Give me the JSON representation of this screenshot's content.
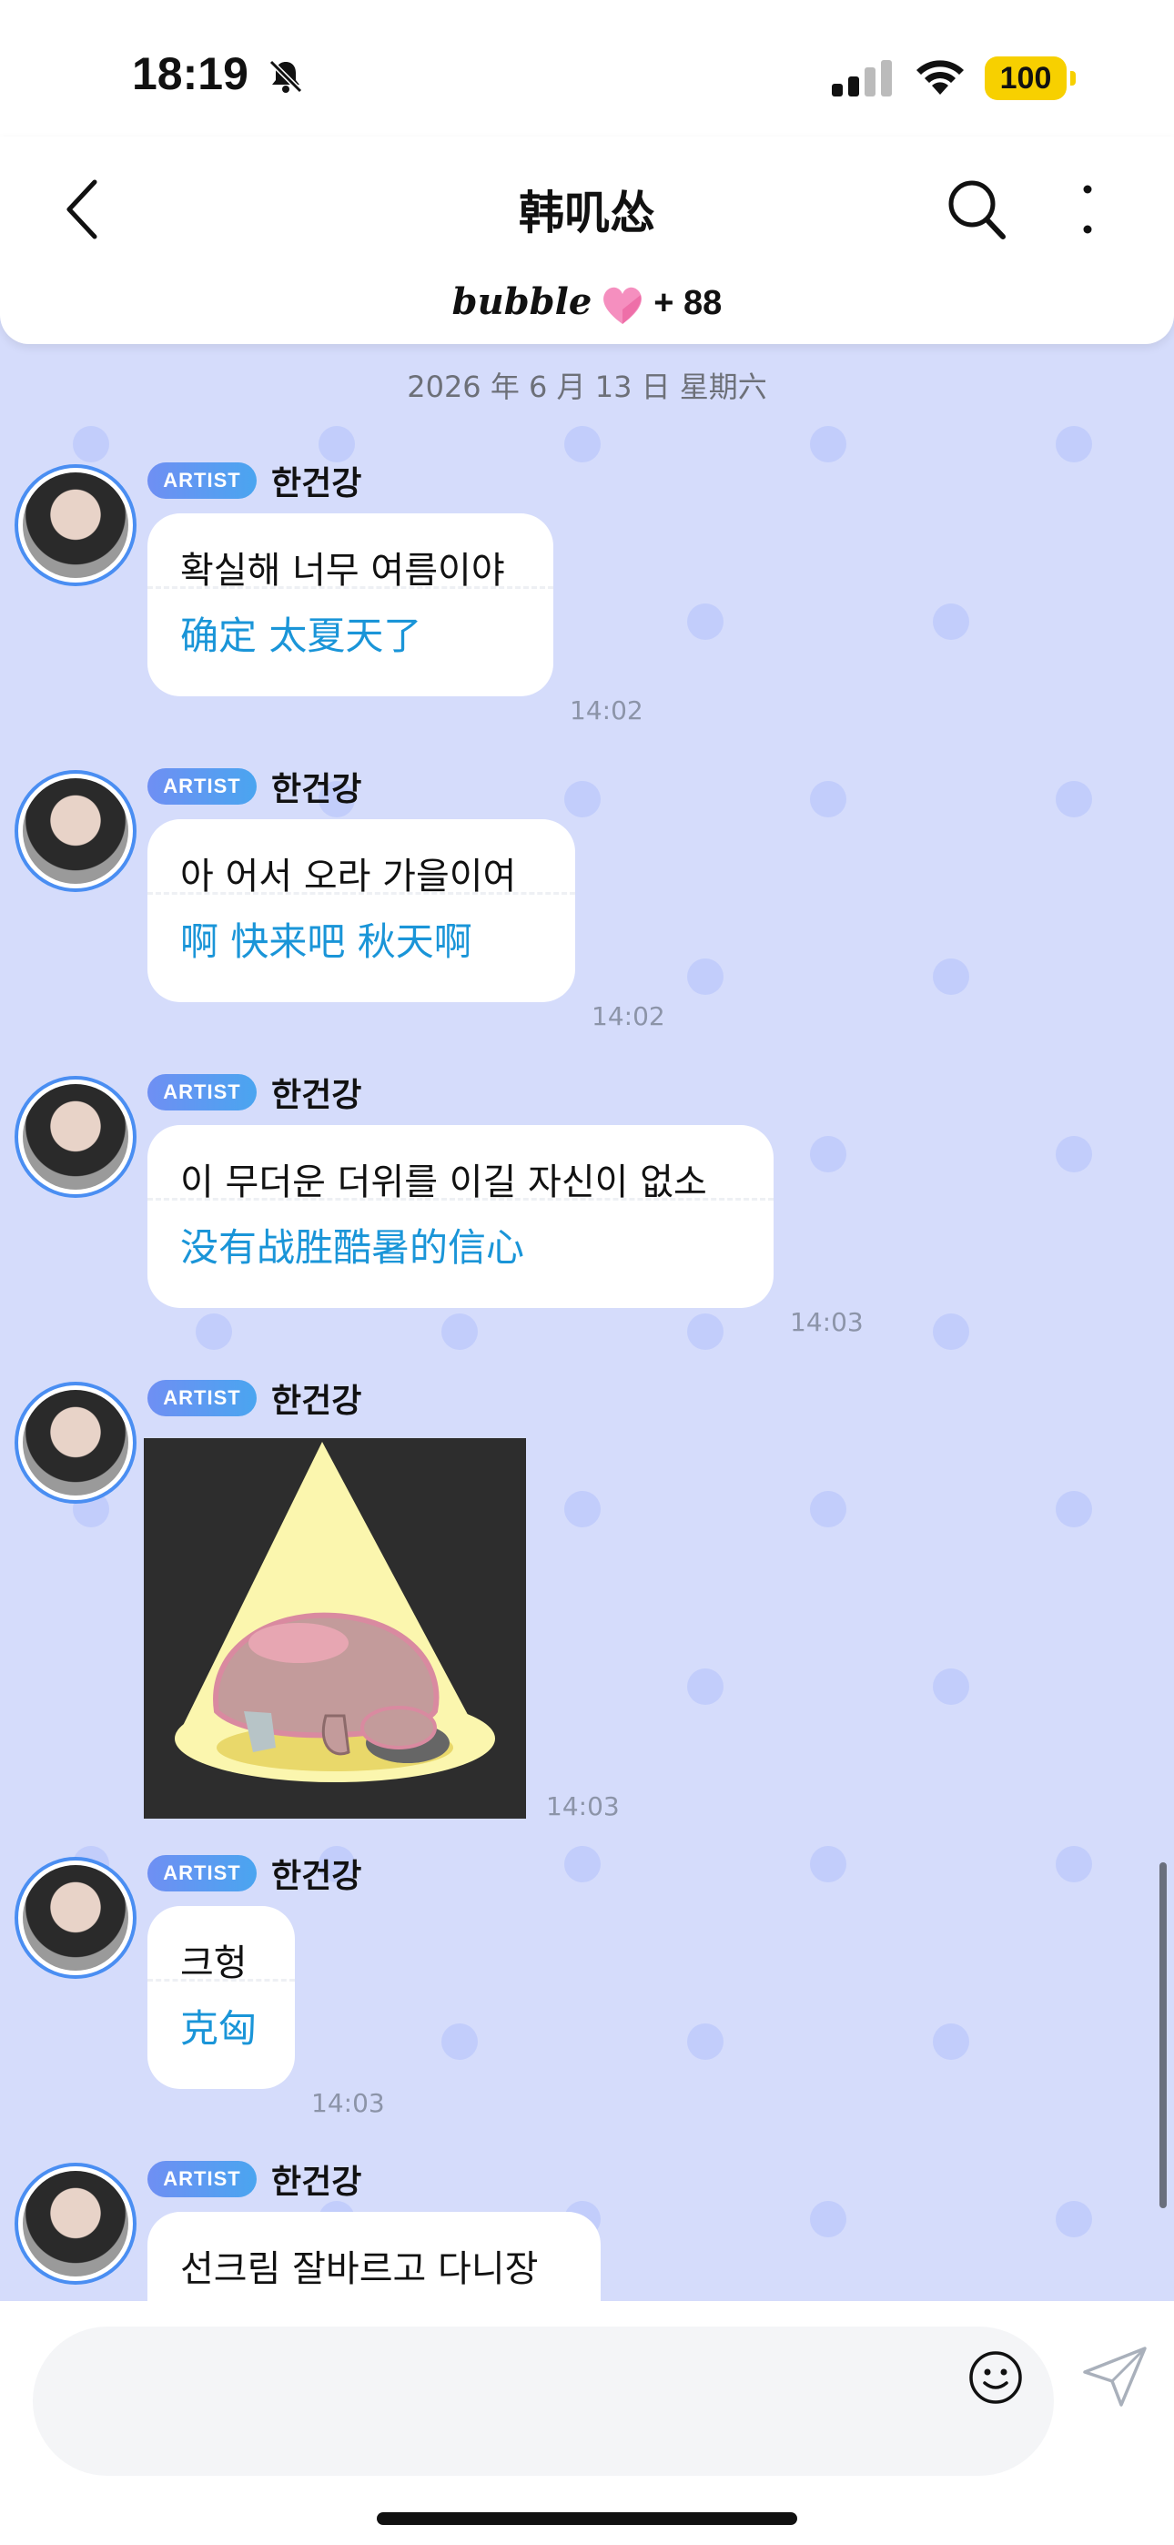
{
  "status_bar": {
    "time": "18:19",
    "battery": "100",
    "icons": [
      "bell-slash-icon",
      "signal-icon",
      "wifi-icon",
      "battery-icon"
    ]
  },
  "header": {
    "title": "韩叽怂",
    "bubble_logo": "bubble",
    "bubble_count": "+ 88",
    "icons": [
      "back-chevron-icon",
      "search-icon",
      "more-vertical-icon",
      "heart-icon"
    ]
  },
  "chat": {
    "date": "2026 年 6 月 13 日  星期六",
    "badge": "ARTIST",
    "sender": "한건강",
    "messages": [
      {
        "ko": "확실해 너무 여름이야",
        "zh": "确定 太夏天了",
        "time": "14:02"
      },
      {
        "ko": " 아 어서 오라 가을이여",
        "zh": "啊 快来吧 秋天啊",
        "time": "14:02"
      },
      {
        "ko": " 이 무더운 더위를 이길 자신이 없소",
        "zh": "没有战胜酷暑的信心",
        "time": "14:03"
      },
      {
        "sticker": "spotlight-character-sticker",
        "time": "14:03"
      },
      {
        "ko": "크헝",
        "zh": "克匈",
        "time": "14:03"
      },
      {
        "ko": " 선크림 잘바르고 다니장",
        "zh": "",
        "time": ""
      }
    ]
  },
  "composer": {
    "placeholder": "",
    "icons": [
      "emoji-icon",
      "send-icon"
    ]
  },
  "colors": {
    "chat_bg": "#d5dcfb",
    "translation": "#1a95d8",
    "badge": "#5b9af2",
    "battery": "#f7d000"
  }
}
